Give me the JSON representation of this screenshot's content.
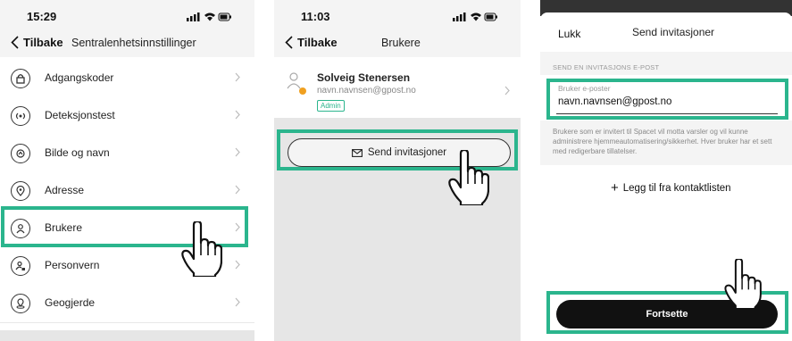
{
  "screen1": {
    "time": "15:29",
    "back_label": "Tilbake",
    "title": "Sentralenhetsinnstillinger",
    "items": [
      {
        "label": "Adgangskoder",
        "icon": "lock-icon"
      },
      {
        "label": "Deteksjonstest",
        "icon": "signal-icon"
      },
      {
        "label": "Bilde og navn",
        "icon": "image-icon"
      },
      {
        "label": "Adresse",
        "icon": "location-pin-icon"
      },
      {
        "label": "Brukere",
        "icon": "user-icon"
      },
      {
        "label": "Personvern",
        "icon": "user-lock-icon"
      },
      {
        "label": "Geogjerde",
        "icon": "geofence-icon"
      }
    ]
  },
  "screen2": {
    "time": "11:03",
    "back_label": "Tilbake",
    "title": "Brukere",
    "user": {
      "name": "Solveig Stenersen",
      "email": "navn.navnsen@gpost.no",
      "role": "Admin"
    },
    "send_button": "Send invitasjoner"
  },
  "screen3": {
    "close_label": "Lukk",
    "title": "Send invitasjoner",
    "section_label": "SEND EN INVITASJONS E-POST",
    "field_label": "Bruker e-poster",
    "field_value": "navn.navnsen@gpost.no",
    "description": "Brukere som er invitert til Spacet vil motta varsler og vil kunne administrere hjemmeautomatisering/sikkerhet. Hver bruker har et sett med redigerbare tillatelser.",
    "add_contacts": "Legg til fra kontaktlisten",
    "continue_button": "Fortsette"
  },
  "colors": {
    "highlight": "#2bb58d",
    "badge": "#2bb58d",
    "avatar_dot": "#f0a020",
    "button_dark": "#111111"
  }
}
